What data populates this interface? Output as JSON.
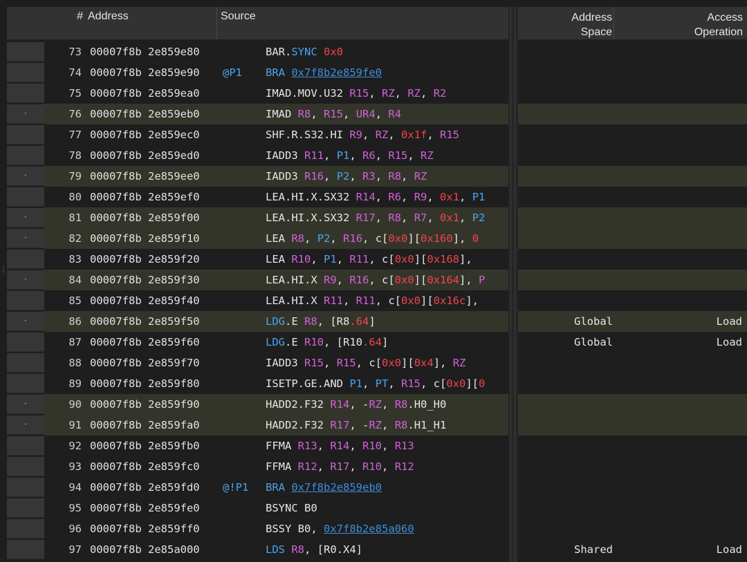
{
  "colors": {
    "mnemonic": "#e6e6e6",
    "mnemonic_blue": "#4aa3ee",
    "register": "#d062d8",
    "register_blue": "#4aa3ee",
    "immediate": "#f2434a",
    "link": "#3b8fdc",
    "highlight_row": "#34352a"
  },
  "header": {
    "num": "#",
    "address": "Address",
    "source": "Source",
    "address_space": [
      "Address",
      "Space"
    ],
    "access_operation": [
      "Access",
      "Operation"
    ]
  },
  "rows": [
    {
      "num": "73",
      "addr": "00007f8b 2e859e80",
      "pred": "",
      "hl": false,
      "aspace": "",
      "aop": "",
      "tokens": [
        [
          "m",
          "BAR"
        ],
        [
          "p",
          "."
        ],
        [
          "mb",
          "SYNC"
        ],
        [
          "p",
          " "
        ],
        [
          "i",
          "0x0"
        ]
      ]
    },
    {
      "num": "74",
      "addr": "00007f8b 2e859e90",
      "pred": "@P1",
      "hl": false,
      "aspace": "",
      "aop": "",
      "tokens": [
        [
          "mb",
          "BRA"
        ],
        [
          "p",
          " "
        ],
        [
          "l",
          "0x7f8b2e859fe0"
        ]
      ]
    },
    {
      "num": "75",
      "addr": "00007f8b 2e859ea0",
      "pred": "",
      "hl": false,
      "aspace": "",
      "aop": "",
      "tokens": [
        [
          "m",
          "IMAD.MOV.U32"
        ],
        [
          "p",
          " "
        ],
        [
          "r",
          "R15"
        ],
        [
          "p",
          ", "
        ],
        [
          "r",
          "RZ"
        ],
        [
          "p",
          ", "
        ],
        [
          "r",
          "RZ"
        ],
        [
          "p",
          ", "
        ],
        [
          "r",
          "R2"
        ]
      ]
    },
    {
      "num": "76",
      "addr": "00007f8b 2e859eb0",
      "pred": "",
      "hl": true,
      "aspace": "",
      "aop": "",
      "tokens": [
        [
          "m",
          "IMAD"
        ],
        [
          "p",
          " "
        ],
        [
          "r",
          "R8"
        ],
        [
          "p",
          ", "
        ],
        [
          "r",
          "R15"
        ],
        [
          "p",
          ", "
        ],
        [
          "r",
          "UR4"
        ],
        [
          "p",
          ", "
        ],
        [
          "r",
          "R4"
        ]
      ]
    },
    {
      "num": "77",
      "addr": "00007f8b 2e859ec0",
      "pred": "",
      "hl": false,
      "aspace": "",
      "aop": "",
      "tokens": [
        [
          "m",
          "SHF.R.S32.HI"
        ],
        [
          "p",
          " "
        ],
        [
          "r",
          "R9"
        ],
        [
          "p",
          ", "
        ],
        [
          "r",
          "RZ"
        ],
        [
          "p",
          ", "
        ],
        [
          "i",
          "0x1f"
        ],
        [
          "p",
          ", "
        ],
        [
          "r",
          "R15"
        ]
      ]
    },
    {
      "num": "78",
      "addr": "00007f8b 2e859ed0",
      "pred": "",
      "hl": false,
      "aspace": "",
      "aop": "",
      "tokens": [
        [
          "m",
          "IADD3"
        ],
        [
          "p",
          " "
        ],
        [
          "r",
          "R11"
        ],
        [
          "p",
          ", "
        ],
        [
          "rb",
          "P1"
        ],
        [
          "p",
          ", "
        ],
        [
          "r",
          "R6"
        ],
        [
          "p",
          ", "
        ],
        [
          "r",
          "R15"
        ],
        [
          "p",
          ", "
        ],
        [
          "r",
          "RZ"
        ]
      ]
    },
    {
      "num": "79",
      "addr": "00007f8b 2e859ee0",
      "pred": "",
      "hl": true,
      "aspace": "",
      "aop": "",
      "tokens": [
        [
          "m",
          "IADD3"
        ],
        [
          "p",
          " "
        ],
        [
          "r",
          "R16"
        ],
        [
          "p",
          ", "
        ],
        [
          "rb",
          "P2"
        ],
        [
          "p",
          ", "
        ],
        [
          "r",
          "R3"
        ],
        [
          "p",
          ", "
        ],
        [
          "r",
          "R8"
        ],
        [
          "p",
          ", "
        ],
        [
          "r",
          "RZ"
        ]
      ]
    },
    {
      "num": "80",
      "addr": "00007f8b 2e859ef0",
      "pred": "",
      "hl": false,
      "aspace": "",
      "aop": "",
      "tokens": [
        [
          "m",
          "LEA.HI.X.SX32"
        ],
        [
          "p",
          " "
        ],
        [
          "r",
          "R14"
        ],
        [
          "p",
          ", "
        ],
        [
          "r",
          "R6"
        ],
        [
          "p",
          ", "
        ],
        [
          "r",
          "R9"
        ],
        [
          "p",
          ", "
        ],
        [
          "i",
          "0x1"
        ],
        [
          "p",
          ", "
        ],
        [
          "rb",
          "P1"
        ]
      ]
    },
    {
      "num": "81",
      "addr": "00007f8b 2e859f00",
      "pred": "",
      "hl": true,
      "aspace": "",
      "aop": "",
      "tokens": [
        [
          "m",
          "LEA.HI.X.SX32"
        ],
        [
          "p",
          " "
        ],
        [
          "r",
          "R17"
        ],
        [
          "p",
          ", "
        ],
        [
          "r",
          "R8"
        ],
        [
          "p",
          ", "
        ],
        [
          "r",
          "R7"
        ],
        [
          "p",
          ", "
        ],
        [
          "i",
          "0x1"
        ],
        [
          "p",
          ", "
        ],
        [
          "rb",
          "P2"
        ]
      ]
    },
    {
      "num": "82",
      "addr": "00007f8b 2e859f10",
      "pred": "",
      "hl": true,
      "aspace": "",
      "aop": "",
      "tokens": [
        [
          "m",
          "LEA"
        ],
        [
          "p",
          " "
        ],
        [
          "r",
          "R8"
        ],
        [
          "p",
          ", "
        ],
        [
          "rb",
          "P2"
        ],
        [
          "p",
          ", "
        ],
        [
          "r",
          "R16"
        ],
        [
          "p",
          ", c["
        ],
        [
          "i",
          "0x0"
        ],
        [
          "p",
          "]["
        ],
        [
          "i",
          "0x160"
        ],
        [
          "p",
          "], "
        ],
        [
          "i",
          "0"
        ]
      ]
    },
    {
      "num": "83",
      "addr": "00007f8b 2e859f20",
      "pred": "",
      "hl": false,
      "aspace": "",
      "aop": "",
      "tokens": [
        [
          "m",
          "LEA"
        ],
        [
          "p",
          " "
        ],
        [
          "r",
          "R10"
        ],
        [
          "p",
          ", "
        ],
        [
          "rb",
          "P1"
        ],
        [
          "p",
          ", "
        ],
        [
          "r",
          "R11"
        ],
        [
          "p",
          ", c["
        ],
        [
          "i",
          "0x0"
        ],
        [
          "p",
          "]["
        ],
        [
          "i",
          "0x168"
        ],
        [
          "p",
          "],"
        ]
      ]
    },
    {
      "num": "84",
      "addr": "00007f8b 2e859f30",
      "pred": "",
      "hl": true,
      "aspace": "",
      "aop": "",
      "tokens": [
        [
          "m",
          "LEA.HI.X"
        ],
        [
          "p",
          " "
        ],
        [
          "r",
          "R9"
        ],
        [
          "p",
          ", "
        ],
        [
          "r",
          "R16"
        ],
        [
          "p",
          ", c["
        ],
        [
          "i",
          "0x0"
        ],
        [
          "p",
          "]["
        ],
        [
          "i",
          "0x164"
        ],
        [
          "p",
          "], "
        ],
        [
          "r",
          "P"
        ]
      ]
    },
    {
      "num": "85",
      "addr": "00007f8b 2e859f40",
      "pred": "",
      "hl": false,
      "aspace": "",
      "aop": "",
      "tokens": [
        [
          "m",
          "LEA.HI.X"
        ],
        [
          "p",
          " "
        ],
        [
          "r",
          "R11"
        ],
        [
          "p",
          ", "
        ],
        [
          "r",
          "R11"
        ],
        [
          "p",
          ", c["
        ],
        [
          "i",
          "0x0"
        ],
        [
          "p",
          "]["
        ],
        [
          "i",
          "0x16c"
        ],
        [
          "p",
          "],"
        ]
      ]
    },
    {
      "num": "86",
      "addr": "00007f8b 2e859f50",
      "pred": "",
      "hl": true,
      "aspace": "Global",
      "aop": "Load",
      "tokens": [
        [
          "mb",
          "LDG"
        ],
        [
          "p",
          ".E "
        ],
        [
          "r",
          "R8"
        ],
        [
          "p",
          ", [R8"
        ],
        [
          "i",
          ".64"
        ],
        [
          "p",
          "]"
        ]
      ]
    },
    {
      "num": "87",
      "addr": "00007f8b 2e859f60",
      "pred": "",
      "hl": false,
      "aspace": "Global",
      "aop": "Load",
      "tokens": [
        [
          "mb",
          "LDG"
        ],
        [
          "p",
          ".E "
        ],
        [
          "r",
          "R10"
        ],
        [
          "p",
          ", [R10"
        ],
        [
          "i",
          ".64"
        ],
        [
          "p",
          "]"
        ]
      ]
    },
    {
      "num": "88",
      "addr": "00007f8b 2e859f70",
      "pred": "",
      "hl": false,
      "aspace": "",
      "aop": "",
      "tokens": [
        [
          "m",
          "IADD3"
        ],
        [
          "p",
          " "
        ],
        [
          "r",
          "R15"
        ],
        [
          "p",
          ", "
        ],
        [
          "r",
          "R15"
        ],
        [
          "p",
          ", c["
        ],
        [
          "i",
          "0x0"
        ],
        [
          "p",
          "]["
        ],
        [
          "i",
          "0x4"
        ],
        [
          "p",
          "], "
        ],
        [
          "r",
          "RZ"
        ]
      ]
    },
    {
      "num": "89",
      "addr": "00007f8b 2e859f80",
      "pred": "",
      "hl": false,
      "aspace": "",
      "aop": "",
      "tokens": [
        [
          "m",
          "ISETP.GE.AND"
        ],
        [
          "p",
          " "
        ],
        [
          "rb",
          "P1"
        ],
        [
          "p",
          ", "
        ],
        [
          "rb",
          "PT"
        ],
        [
          "p",
          ", "
        ],
        [
          "r",
          "R15"
        ],
        [
          "p",
          ", c["
        ],
        [
          "i",
          "0x0"
        ],
        [
          "p",
          "]["
        ],
        [
          "i",
          "0"
        ]
      ]
    },
    {
      "num": "90",
      "addr": "00007f8b 2e859f90",
      "pred": "",
      "hl": true,
      "aspace": "",
      "aop": "",
      "tokens": [
        [
          "m",
          "HADD2.F32"
        ],
        [
          "p",
          " "
        ],
        [
          "r",
          "R14"
        ],
        [
          "p",
          ", -"
        ],
        [
          "r",
          "RZ"
        ],
        [
          "p",
          ", "
        ],
        [
          "r",
          "R8"
        ],
        [
          "p",
          ".H0_H0"
        ]
      ]
    },
    {
      "num": "91",
      "addr": "00007f8b 2e859fa0",
      "pred": "",
      "hl": true,
      "aspace": "",
      "aop": "",
      "tokens": [
        [
          "m",
          "HADD2.F32"
        ],
        [
          "p",
          " "
        ],
        [
          "r",
          "R17"
        ],
        [
          "p",
          ", -"
        ],
        [
          "r",
          "RZ"
        ],
        [
          "p",
          ", "
        ],
        [
          "r",
          "R8"
        ],
        [
          "p",
          ".H1_H1"
        ]
      ]
    },
    {
      "num": "92",
      "addr": "00007f8b 2e859fb0",
      "pred": "",
      "hl": false,
      "aspace": "",
      "aop": "",
      "tokens": [
        [
          "m",
          "FFMA"
        ],
        [
          "p",
          " "
        ],
        [
          "r",
          "R13"
        ],
        [
          "p",
          ", "
        ],
        [
          "r",
          "R14"
        ],
        [
          "p",
          ", "
        ],
        [
          "r",
          "R10"
        ],
        [
          "p",
          ", "
        ],
        [
          "r",
          "R13"
        ]
      ]
    },
    {
      "num": "93",
      "addr": "00007f8b 2e859fc0",
      "pred": "",
      "hl": false,
      "aspace": "",
      "aop": "",
      "tokens": [
        [
          "m",
          "FFMA"
        ],
        [
          "p",
          " "
        ],
        [
          "r",
          "R12"
        ],
        [
          "p",
          ", "
        ],
        [
          "r",
          "R17"
        ],
        [
          "p",
          ", "
        ],
        [
          "r",
          "R10"
        ],
        [
          "p",
          ", "
        ],
        [
          "r",
          "R12"
        ]
      ]
    },
    {
      "num": "94",
      "addr": "00007f8b 2e859fd0",
      "pred": "@!P1",
      "hl": false,
      "aspace": "",
      "aop": "",
      "tokens": [
        [
          "mb",
          "BRA"
        ],
        [
          "p",
          " "
        ],
        [
          "l",
          "0x7f8b2e859eb0"
        ]
      ]
    },
    {
      "num": "95",
      "addr": "00007f8b 2e859fe0",
      "pred": "",
      "hl": false,
      "aspace": "",
      "aop": "",
      "tokens": [
        [
          "m",
          "BSYNC B0"
        ]
      ]
    },
    {
      "num": "96",
      "addr": "00007f8b 2e859ff0",
      "pred": "",
      "hl": false,
      "aspace": "",
      "aop": "",
      "tokens": [
        [
          "m",
          "BSSY"
        ],
        [
          "p",
          " B0, "
        ],
        [
          "l",
          "0x7f8b2e85a060"
        ]
      ]
    },
    {
      "num": "97",
      "addr": "00007f8b 2e85a000",
      "pred": "",
      "hl": false,
      "aspace": "Shared",
      "aop": "Load",
      "tokens": [
        [
          "mb",
          "LDS"
        ],
        [
          "p",
          " "
        ],
        [
          "r",
          "R8"
        ],
        [
          "p",
          ", [R0.X4]"
        ]
      ]
    }
  ]
}
